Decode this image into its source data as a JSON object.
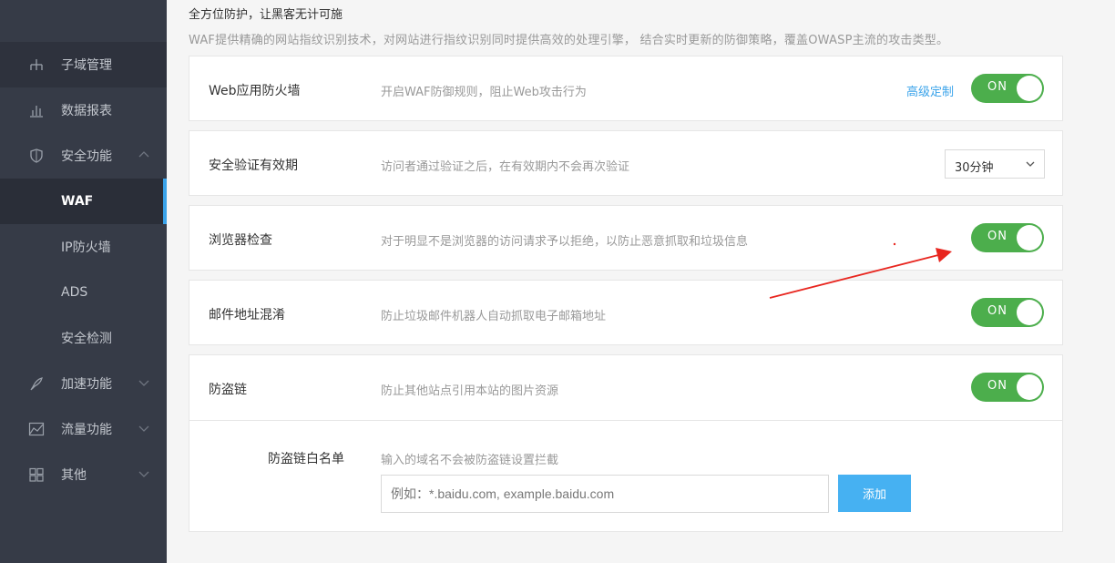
{
  "sidebar": {
    "items": [
      {
        "label": "子域管理",
        "icon": "sitemap-icon"
      },
      {
        "label": "数据报表",
        "icon": "bar-chart-icon"
      },
      {
        "label": "安全功能",
        "icon": "shield-icon"
      },
      {
        "label": "WAF"
      },
      {
        "label": "IP防火墙"
      },
      {
        "label": "ADS"
      },
      {
        "label": "安全检测"
      },
      {
        "label": "加速功能",
        "icon": "rocket-icon"
      },
      {
        "label": "流量功能",
        "icon": "area-chart-icon"
      },
      {
        "label": "其他",
        "icon": "grid-icon"
      }
    ],
    "active": "WAF",
    "accent": "#3aa3ea"
  },
  "section": {
    "title": "全方位防护，让黑客无计可施",
    "description": "WAF提供精确的网站指纹识别技术，对网站进行指纹识别同时提供高效的处理引擎， 结合实时更新的防御策略，覆盖OWASP主流的攻击类型。"
  },
  "settings": {
    "waf": {
      "name": "Web应用防火墙",
      "desc": "开启WAF防御规则，阻止Web攻击行为",
      "link": "高级定制",
      "toggle": "ON"
    },
    "verify": {
      "name": "安全验证有效期",
      "desc": "访问者通过验证之后，在有效期内不会再次验证",
      "select_value": "30分钟"
    },
    "browser": {
      "name": "浏览器检查",
      "desc": "对于明显不是浏览器的访问请求予以拒绝，以防止恶意抓取和垃圾信息",
      "toggle": "ON"
    },
    "email": {
      "name": "邮件地址混淆",
      "desc": "防止垃圾邮件机器人自动抓取电子邮箱地址",
      "toggle": "ON"
    },
    "hotlink": {
      "name": "防盗链",
      "desc": "防止其他站点引用本站的图片资源",
      "toggle": "ON"
    }
  },
  "whitelist": {
    "label": "防盗链白名单",
    "hint": "输入的域名不会被防盗链设置拦截",
    "placeholder": "例如：*.baidu.com, example.baidu.com",
    "button": "添加"
  },
  "colors": {
    "toggle_on": "#4cae4c",
    "annotation_arrow": "#e8261f",
    "button": "#46b1f2"
  }
}
